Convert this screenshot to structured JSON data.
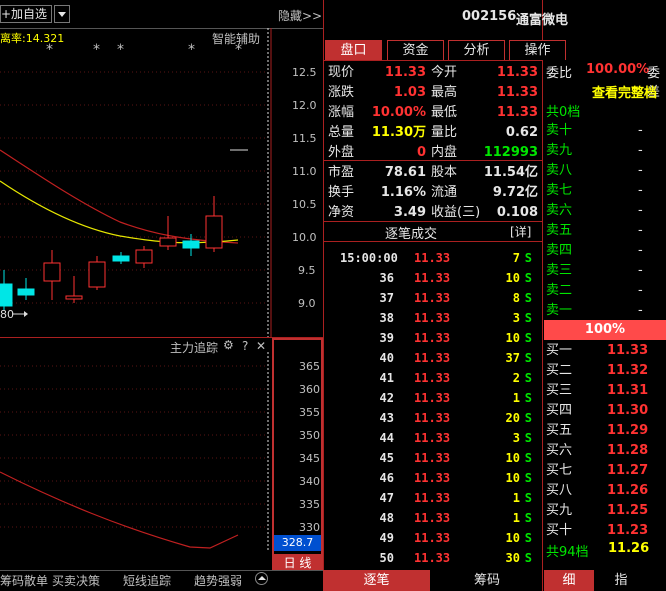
{
  "left": {
    "add_watch_label": "+加自选",
    "deviation_label": "离率:14.321",
    "hide_label": "隐藏>>",
    "smart_assist_label": "智能辅助",
    "asterisks": [
      "*",
      "*",
      "*",
      "*",
      "*"
    ],
    "price_ticks": [
      "12.5",
      "12.0",
      "11.5",
      "11.0",
      "10.5",
      "10.0",
      "9.5",
      "9.0"
    ],
    "low_marker": "80",
    "sub_title": "主力追踪",
    "sub_icons": [
      "⚙",
      "?",
      "✕"
    ],
    "sub_ticks": [
      "365",
      "360",
      "355",
      "350",
      "345",
      "340",
      "335",
      "330"
    ],
    "sub_current": "328.7",
    "period_label": "日 线",
    "bottom_tabs": [
      "筹码散单",
      "买卖决策",
      "短线追踪",
      "趋势强弱"
    ],
    "colors": {
      "up": "#ff3232",
      "down": "#00e6e6",
      "ma_yellow": "#e6e600",
      "ma_red": "#c02020"
    }
  },
  "header": {
    "code": "002156",
    "name": "通富微电"
  },
  "tabs": [
    {
      "label": "盘口",
      "active": true
    },
    {
      "label": "资金",
      "active": false
    },
    {
      "label": "分析",
      "active": false
    },
    {
      "label": "操作",
      "active": false
    }
  ],
  "quote": {
    "rows": [
      {
        "l1": "现价",
        "v1": "11.33",
        "c1": "red",
        "l2": "今开",
        "v2": "11.33",
        "c2": "red"
      },
      {
        "l1": "涨跌",
        "v1": "1.03",
        "c1": "red",
        "l2": "最高",
        "v2": "11.33",
        "c2": "red"
      },
      {
        "l1": "涨幅",
        "v1": "10.00%",
        "c1": "red",
        "l2": "最低",
        "v2": "11.33",
        "c2": "red"
      },
      {
        "l1": "总量",
        "v1": "11.30万",
        "c1": "yellow",
        "l2": "量比",
        "v2": "0.62",
        "c2": "white"
      },
      {
        "l1": "外盘",
        "v1": "0",
        "c1": "red",
        "l2": "内盘",
        "v2": "112993",
        "c2": "green"
      },
      {
        "l1": "市盈",
        "v1": "78.61",
        "c1": "white",
        "l2": "股本",
        "v2": "11.54亿",
        "c2": "white"
      },
      {
        "l1": "换手",
        "v1": "1.16%",
        "c1": "white",
        "l2": "流通",
        "v2": "9.72亿",
        "c2": "white"
      },
      {
        "l1": "净资",
        "v1": "3.49",
        "c1": "white",
        "l2": "收益(三)",
        "v2": "0.108",
        "c2": "white"
      }
    ]
  },
  "ticks": {
    "title": "逐笔成交",
    "detail_label": "[详]",
    "rows": [
      {
        "time": "15:00:00",
        "price": "11.33",
        "vol": "7",
        "side": "S"
      },
      {
        "time": "36",
        "price": "11.33",
        "vol": "10",
        "side": "S"
      },
      {
        "time": "37",
        "price": "11.33",
        "vol": "8",
        "side": "S"
      },
      {
        "time": "38",
        "price": "11.33",
        "vol": "3",
        "side": "S"
      },
      {
        "time": "39",
        "price": "11.33",
        "vol": "10",
        "side": "S"
      },
      {
        "time": "40",
        "price": "11.33",
        "vol": "37",
        "side": "S"
      },
      {
        "time": "41",
        "price": "11.33",
        "vol": "2",
        "side": "S"
      },
      {
        "time": "42",
        "price": "11.33",
        "vol": "1",
        "side": "S"
      },
      {
        "time": "43",
        "price": "11.33",
        "vol": "20",
        "side": "S"
      },
      {
        "time": "44",
        "price": "11.33",
        "vol": "3",
        "side": "S"
      },
      {
        "time": "45",
        "price": "11.33",
        "vol": "10",
        "side": "S"
      },
      {
        "time": "46",
        "price": "11.33",
        "vol": "10",
        "side": "S"
      },
      {
        "time": "47",
        "price": "11.33",
        "vol": "1",
        "side": "S"
      },
      {
        "time": "48",
        "price": "11.33",
        "vol": "1",
        "side": "S"
      },
      {
        "time": "49",
        "price": "11.33",
        "vol": "10",
        "side": "S"
      },
      {
        "time": "50",
        "price": "11.33",
        "vol": "30",
        "side": "S"
      }
    ],
    "bottom_tabs": [
      "逐笔",
      "筹码"
    ]
  },
  "orderbook": {
    "ratio_label": "委比",
    "ratio_value": "100.00%",
    "ratio_trailing": "委差",
    "view_full_label": "查看完整档",
    "total_sell_label": "共0档",
    "sell": [
      {
        "label": "卖十",
        "price": "-"
      },
      {
        "label": "卖九",
        "price": "-"
      },
      {
        "label": "卖八",
        "price": "-"
      },
      {
        "label": "卖七",
        "price": "-"
      },
      {
        "label": "卖六",
        "price": "-"
      },
      {
        "label": "卖五",
        "price": "-"
      },
      {
        "label": "卖四",
        "price": "-"
      },
      {
        "label": "卖三",
        "price": "-"
      },
      {
        "label": "卖二",
        "price": "-"
      },
      {
        "label": "卖一",
        "price": "-"
      }
    ],
    "bar_value": "100%",
    "buy": [
      {
        "label": "买一",
        "price": "11.33"
      },
      {
        "label": "买二",
        "price": "11.32"
      },
      {
        "label": "买三",
        "price": "11.31"
      },
      {
        "label": "买四",
        "price": "11.30"
      },
      {
        "label": "买五",
        "price": "11.29"
      },
      {
        "label": "买六",
        "price": "11.28"
      },
      {
        "label": "买七",
        "price": "11.27"
      },
      {
        "label": "买八",
        "price": "11.26"
      },
      {
        "label": "买九",
        "price": "11.25"
      },
      {
        "label": "买十",
        "price": "11.23"
      }
    ],
    "total_buy_label": "共94档",
    "total_buy_price": "11.26",
    "bottom_tabs": [
      "细",
      "指"
    ]
  }
}
